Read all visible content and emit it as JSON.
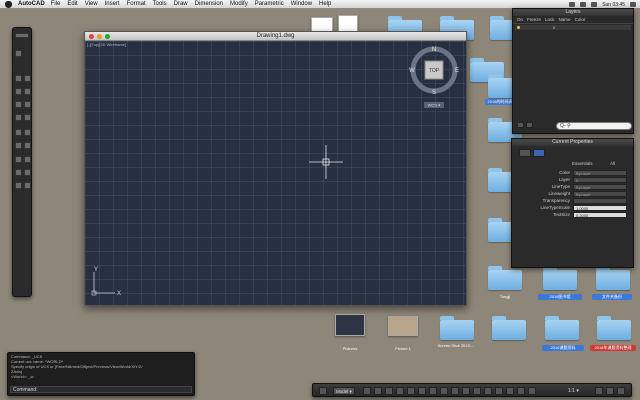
{
  "menubar": {
    "app": "AutoCAD",
    "items": [
      "File",
      "Edit",
      "View",
      "Insert",
      "Format",
      "Tools",
      "Draw",
      "Dimension",
      "Modify",
      "Parametric",
      "Window",
      "Help"
    ],
    "status_time": "Sun 03:45"
  },
  "drawing": {
    "title": "Drawing1.dwg",
    "view_label": "[-][Top][2D Wireframe]",
    "viewcube_face": "TOP",
    "compass": {
      "n": "N",
      "s": "S",
      "e": "E",
      "w": "W"
    },
    "wcs_label": "WCS ▾",
    "axis_x": "X",
    "axis_y": "Y"
  },
  "layers": {
    "title": "Layers",
    "columns": [
      "On",
      "Freeze",
      "Lock",
      "Name",
      "Color"
    ],
    "rows": [
      {
        "name": "0"
      }
    ],
    "search_placeholder": "Q- ⚲"
  },
  "properties": {
    "title": "Current Properties",
    "section": "Essentials",
    "section_all": "All",
    "rows": [
      {
        "label": "Color",
        "value": "ByLayer"
      },
      {
        "label": "Layer",
        "value": "0"
      },
      {
        "label": "LineType",
        "value": "ByLayer"
      },
      {
        "label": "Lineweight",
        "value": "ByLayer"
      },
      {
        "label": "Transparency",
        "value": ""
      },
      {
        "label": "LineTypeScale",
        "value": "1.0000"
      },
      {
        "label": "TextSize",
        "value": "0.2000"
      }
    ]
  },
  "command": {
    "history": [
      "Command: _UCS",
      "Current ucs name: *WORLD*",
      "Specify origin of UCS or [Face/NAmed/OBject/Previous/View/World/X/Y/Z/",
      "ZAxis]",
      "<World>: _w"
    ],
    "prompt": "Command:"
  },
  "statusbar": {
    "model_label": "Model ▾",
    "scale": "1:1 ▾"
  },
  "desktop": {
    "labels": [
      "2016的时间表",
      "Pictures",
      "Picture 1",
      "Screen Shot 2013-...",
      "Tongji",
      "2016图书馆",
      "2016课题资料",
      "文件夹备份",
      "2016年课题资料整理"
    ]
  },
  "colors": {
    "canvas": "#263040",
    "desktop": "#8e8779",
    "folder": "#7fbbe8",
    "panel": "#2a2a2a"
  }
}
